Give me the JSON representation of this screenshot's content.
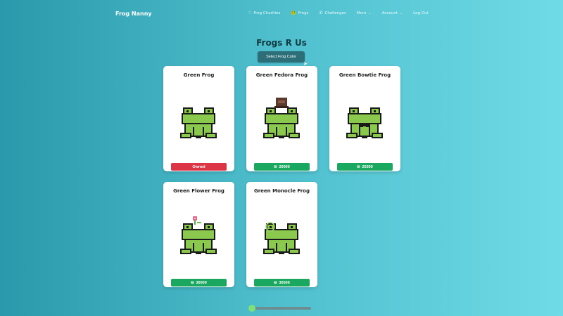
{
  "nav": {
    "brand": "Frog Nanny",
    "links": [
      {
        "label": "Frog Charities",
        "icon": "heart-icon",
        "glyph": "♡"
      },
      {
        "label": "Frogs",
        "icon": "frog-icon",
        "glyph": "🐸"
      },
      {
        "label": "Challenges",
        "icon": "trophy-icon",
        "glyph": "✆"
      },
      {
        "label": "More",
        "icon": "",
        "glyph": ""
      },
      {
        "label": "Account",
        "icon": "",
        "glyph": ""
      },
      {
        "label": "Log Out",
        "icon": "",
        "glyph": ""
      }
    ]
  },
  "page": {
    "title": "Frogs R Us",
    "select_label": "Select Frog Color"
  },
  "cards": [
    {
      "name": "Green Frog",
      "button": "Owned",
      "status": "owned",
      "accessory": "none"
    },
    {
      "name": "Green Fedora Frog",
      "button": "20000",
      "status": "buy",
      "accessory": "fedora"
    },
    {
      "name": "Green Bowtie Frog",
      "button": "20500",
      "status": "buy",
      "accessory": "bowtie"
    },
    {
      "name": "Green Flower Frog",
      "button": "30000",
      "status": "buy",
      "accessory": "flower"
    },
    {
      "name": "Green Monocle Frog",
      "button": "30500",
      "status": "buy",
      "accessory": "monocle"
    }
  ],
  "colors": {
    "frog_green": "#8bc94e",
    "owned": "#dc3545",
    "buy": "#1aa860"
  },
  "slider": {
    "value": 0
  }
}
